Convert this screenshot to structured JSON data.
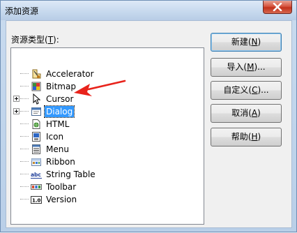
{
  "window": {
    "title": "添加资源"
  },
  "resource_type_label": {
    "text": "资源类型(",
    "key": "T",
    "suffix": "):"
  },
  "tree_items": [
    {
      "label": "Accelerator",
      "icon": "accelerator-icon",
      "expandable": false
    },
    {
      "label": "Bitmap",
      "icon": "bitmap-icon",
      "expandable": false
    },
    {
      "label": "Cursor",
      "icon": "cursor-icon",
      "expandable": true
    },
    {
      "label": "Dialog",
      "icon": "dialog-icon",
      "expandable": true,
      "selected": true
    },
    {
      "label": "HTML",
      "icon": "html-icon",
      "expandable": false
    },
    {
      "label": "Icon",
      "icon": "icon-resource-icon",
      "expandable": false
    },
    {
      "label": "Menu",
      "icon": "menu-icon",
      "expandable": false
    },
    {
      "label": "Ribbon",
      "icon": "ribbon-icon",
      "expandable": false
    },
    {
      "label": "String Table",
      "icon": "string-table-icon",
      "expandable": false
    },
    {
      "label": "Toolbar",
      "icon": "toolbar-icon",
      "expandable": false
    },
    {
      "label": "Version",
      "icon": "version-icon",
      "expandable": false
    }
  ],
  "buttons": {
    "new": {
      "text": "新建(",
      "key": "N",
      "suffix": ")"
    },
    "import": {
      "text": "导入(",
      "key": "M",
      "suffix": ")..."
    },
    "custom": {
      "text": "自定义(",
      "key": "C",
      "suffix": ")..."
    },
    "cancel": {
      "text": "取消(",
      "key": "A",
      "suffix": ")"
    },
    "help": {
      "text": "帮助(",
      "key": "H",
      "suffix": ")"
    }
  },
  "icons": {
    "string_table_glyph": "abc",
    "version_glyph": "1.0"
  },
  "colors": {
    "selection": "#3399ff",
    "annotation_arrow": "#e8231b"
  }
}
